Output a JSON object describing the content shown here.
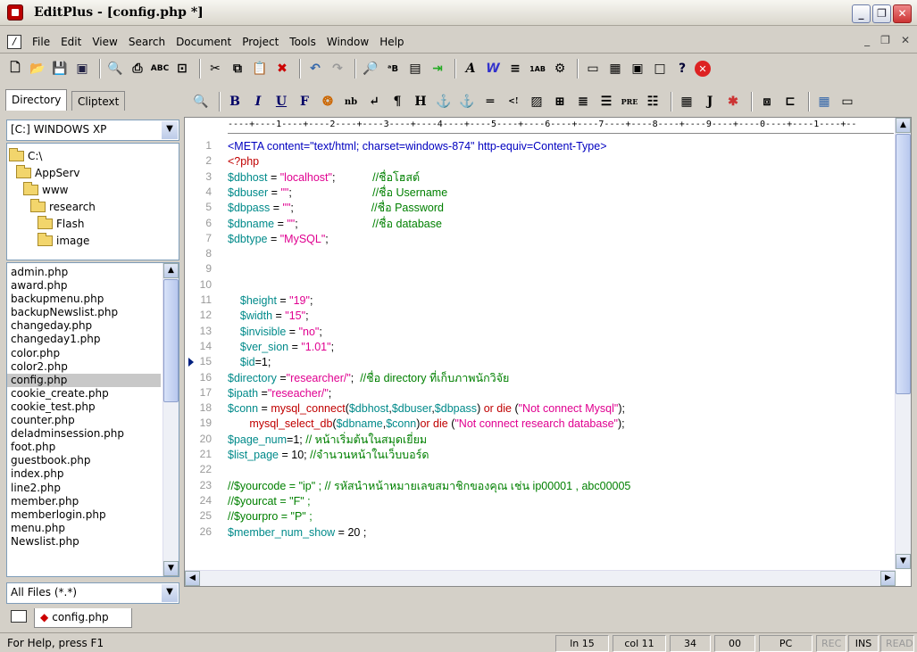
{
  "window": {
    "title": "EditPlus - [config.php *]"
  },
  "menu": {
    "items": [
      "File",
      "Edit",
      "View",
      "Search",
      "Document",
      "Project",
      "Tools",
      "Window",
      "Help"
    ]
  },
  "sidebar": {
    "tabs": [
      "Directory",
      "Cliptext"
    ],
    "drive": "[C:] WINDOWS XP",
    "folders": [
      "C:\\",
      "AppServ",
      "www",
      "research",
      "Flash",
      "image"
    ],
    "files": [
      "admin.php",
      "award.php",
      "backupmenu.php",
      "backupNewslist.php",
      "changeday.php",
      "changeday1.php",
      "color.php",
      "color2.php",
      "config.php",
      "cookie_create.php",
      "cookie_test.php",
      "counter.php",
      "deladminsession.php",
      "foot.php",
      "guestbook.php",
      "index.php",
      "line2.php",
      "member.php",
      "memberlogin.php",
      "menu.php",
      "Newslist.php"
    ],
    "selected_file": "config.php",
    "filter": "All Files (*.*)"
  },
  "editor": {
    "ruler": "----+----1----+----2----+----3----+----4----+----5----+----6----+----7----+----8----+----9----+----0----+----1----+--",
    "current_line": 15,
    "lines": [
      {
        "n": "1",
        "segs": [
          [
            "h",
            "<META content=\"text/html; charset=windows-874\" http-equiv=Content-Type>"
          ]
        ]
      },
      {
        "n": "2",
        "segs": [
          [
            "f",
            "<?php"
          ]
        ]
      },
      {
        "n": "3",
        "segs": [
          [
            "v",
            "$dbhost"
          ],
          [
            "o",
            " = "
          ],
          [
            "s",
            "\"localhost\""
          ],
          [
            "o",
            ";            "
          ],
          [
            "c",
            "//ชื่อโฮสต์"
          ]
        ]
      },
      {
        "n": "4",
        "segs": [
          [
            "v",
            "$dbuser"
          ],
          [
            "o",
            " = "
          ],
          [
            "s",
            "\"\""
          ],
          [
            "o",
            ";                          "
          ],
          [
            "c",
            "//ชื่อ Username"
          ]
        ]
      },
      {
        "n": "5",
        "segs": [
          [
            "v",
            "$dbpass"
          ],
          [
            "o",
            " = "
          ],
          [
            "s",
            "\"\""
          ],
          [
            "o",
            ";                         "
          ],
          [
            "c",
            "//ชื่อ Password"
          ]
        ]
      },
      {
        "n": "6",
        "segs": [
          [
            "v",
            "$dbname"
          ],
          [
            "o",
            " = "
          ],
          [
            "s",
            "\"\""
          ],
          [
            "o",
            ";                        "
          ],
          [
            "c",
            "//ชื่อ database"
          ]
        ]
      },
      {
        "n": "7",
        "segs": [
          [
            "v",
            "$dbtype"
          ],
          [
            "o",
            " = "
          ],
          [
            "s",
            "\"MySQL\""
          ],
          [
            "o",
            ";"
          ]
        ]
      },
      {
        "n": "8",
        "segs": []
      },
      {
        "n": "9",
        "segs": []
      },
      {
        "n": "10",
        "segs": []
      },
      {
        "n": "11",
        "segs": [
          [
            "o",
            "    "
          ],
          [
            "v",
            "$height"
          ],
          [
            "o",
            " = "
          ],
          [
            "s",
            "\"19\""
          ],
          [
            "o",
            ";"
          ]
        ]
      },
      {
        "n": "12",
        "segs": [
          [
            "o",
            "    "
          ],
          [
            "v",
            "$width"
          ],
          [
            "o",
            " = "
          ],
          [
            "s",
            "\"15\""
          ],
          [
            "o",
            ";"
          ]
        ]
      },
      {
        "n": "13",
        "segs": [
          [
            "o",
            "    "
          ],
          [
            "v",
            "$invisible"
          ],
          [
            "o",
            " = "
          ],
          [
            "s",
            "\"no\""
          ],
          [
            "o",
            ";"
          ]
        ]
      },
      {
        "n": "14",
        "segs": [
          [
            "o",
            "    "
          ],
          [
            "v",
            "$ver_sion"
          ],
          [
            "o",
            " = "
          ],
          [
            "s",
            "\"1.01\""
          ],
          [
            "o",
            ";"
          ]
        ]
      },
      {
        "n": "15",
        "segs": [
          [
            "o",
            "    "
          ],
          [
            "v",
            "$id"
          ],
          [
            "o",
            "=1;"
          ]
        ]
      },
      {
        "n": "16",
        "segs": [
          [
            "v",
            "$directory"
          ],
          [
            "o",
            " ="
          ],
          [
            "s",
            "\"researcher/\""
          ],
          [
            "o",
            ";  "
          ],
          [
            "c",
            "//ชื่อ directory ที่เก็บภาพนักวิจัย"
          ]
        ]
      },
      {
        "n": "17",
        "segs": [
          [
            "v",
            "$ipath"
          ],
          [
            "o",
            " ="
          ],
          [
            "s",
            "\"reseacher/\""
          ],
          [
            "o",
            ";"
          ]
        ]
      },
      {
        "n": "18",
        "segs": [
          [
            "v",
            "$conn"
          ],
          [
            "o",
            " = "
          ],
          [
            "f",
            "mysql_connect"
          ],
          [
            "o",
            "("
          ],
          [
            "v",
            "$dbhost"
          ],
          [
            "o",
            ","
          ],
          [
            "v",
            "$dbuser"
          ],
          [
            "o",
            ","
          ],
          [
            "v",
            "$dbpass"
          ],
          [
            "o",
            ") "
          ],
          [
            "f",
            "or die"
          ],
          [
            "o",
            " ("
          ],
          [
            "s",
            "\"Not connect Mysql\""
          ],
          [
            "o",
            ");"
          ]
        ]
      },
      {
        "n": "19",
        "segs": [
          [
            "o",
            "       "
          ],
          [
            "f",
            "mysql_select_db"
          ],
          [
            "o",
            "("
          ],
          [
            "v",
            "$dbname"
          ],
          [
            "o",
            ","
          ],
          [
            "v",
            "$conn"
          ],
          [
            "o",
            ")"
          ],
          [
            "f",
            "or die"
          ],
          [
            "o",
            " ("
          ],
          [
            "s",
            "\"Not connect research database\""
          ],
          [
            "o",
            ");"
          ]
        ]
      },
      {
        "n": "20",
        "segs": [
          [
            "v",
            "$page_num"
          ],
          [
            "o",
            "=1; "
          ],
          [
            "c",
            "// หน้าเริ่มต้นในสมุดเยี่ยม"
          ]
        ]
      },
      {
        "n": "21",
        "segs": [
          [
            "v",
            "$list_page"
          ],
          [
            "o",
            " = 10; "
          ],
          [
            "c",
            "//จำนวนหน้าในเว็บบอร์ด"
          ]
        ]
      },
      {
        "n": "22",
        "segs": []
      },
      {
        "n": "23",
        "segs": [
          [
            "c",
            "//$yourcode = \"ip\" ; // รหัสนำหน้าหมายเลขสมาชิกของคุณ เช่น ip00001 , abc00005"
          ]
        ]
      },
      {
        "n": "24",
        "segs": [
          [
            "c",
            "//$yourcat = \"F\" ;"
          ]
        ]
      },
      {
        "n": "25",
        "segs": [
          [
            "c",
            "//$yourpro = \"P\" ;"
          ]
        ]
      },
      {
        "n": "26",
        "segs": [
          [
            "v",
            "$member_num_show"
          ],
          [
            "o",
            " = 20 ;"
          ]
        ]
      }
    ]
  },
  "doctab": {
    "label": "config.php"
  },
  "status": {
    "help": "For Help, press F1",
    "ln": "ln 15",
    "col": "col 11",
    "num": "34",
    "hex": "00",
    "mode": "PC",
    "rec": "REC",
    "ins": "INS",
    "read": "READ"
  }
}
